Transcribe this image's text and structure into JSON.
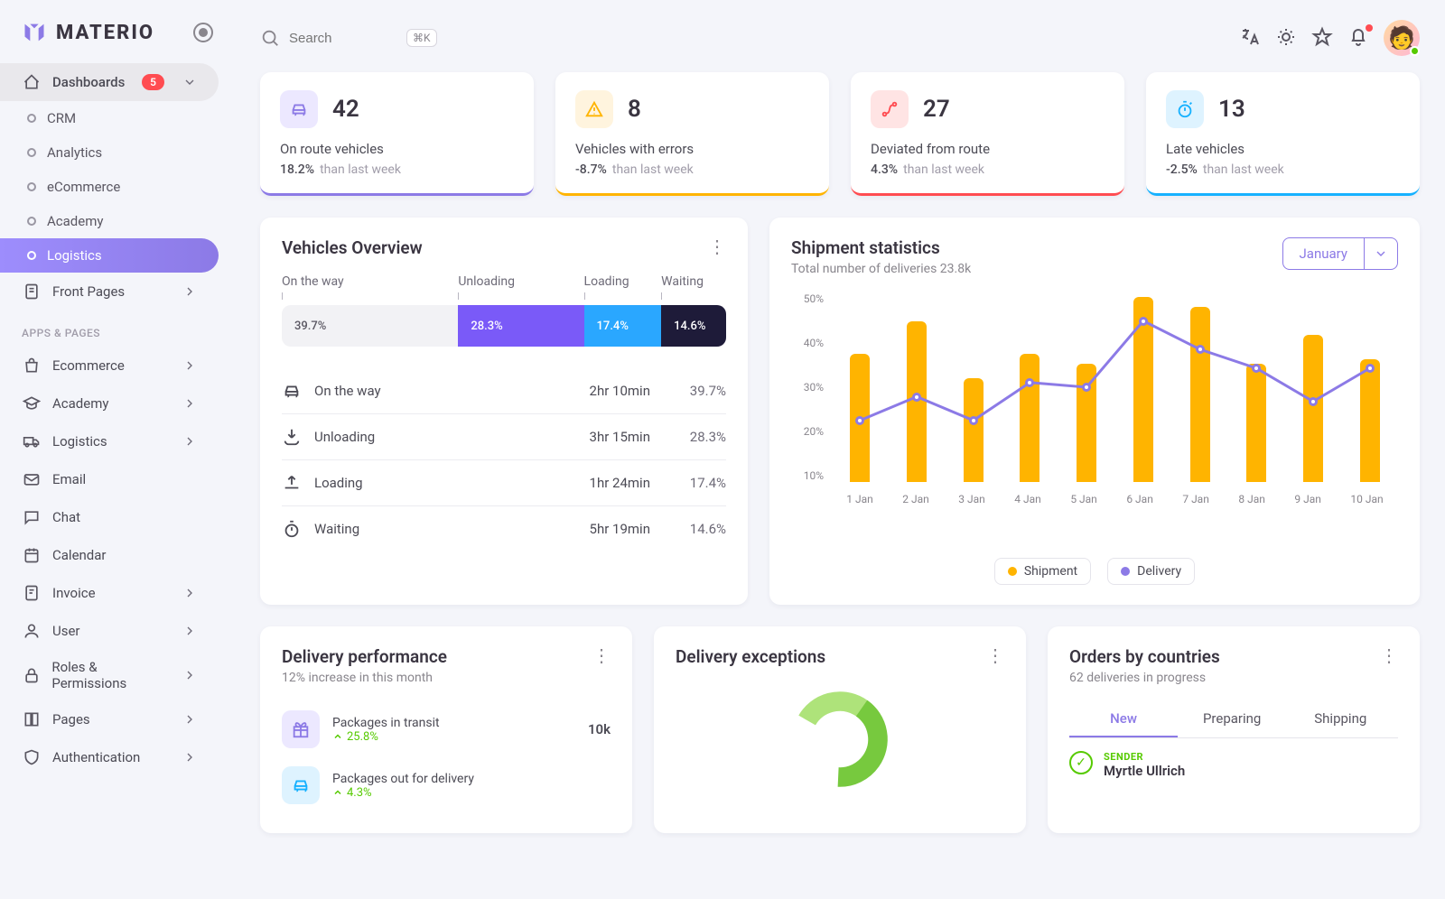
{
  "brand": "MATERIO",
  "search": {
    "placeholder": "Search",
    "kbd": "⌘K"
  },
  "sidebar": {
    "dashboards_label": "Dashboards",
    "dashboards_badge": "5",
    "subs": [
      {
        "label": "CRM"
      },
      {
        "label": "Analytics"
      },
      {
        "label": "eCommerce"
      },
      {
        "label": "Academy"
      },
      {
        "label": "Logistics"
      }
    ],
    "front_pages": "Front Pages",
    "section_heading": "APPS & PAGES",
    "apps": [
      {
        "label": "Ecommerce",
        "chev": true
      },
      {
        "label": "Academy",
        "chev": true
      },
      {
        "label": "Logistics",
        "chev": true
      },
      {
        "label": "Email",
        "chev": false
      },
      {
        "label": "Chat",
        "chev": false
      },
      {
        "label": "Calendar",
        "chev": false
      },
      {
        "label": "Invoice",
        "chev": true
      },
      {
        "label": "User",
        "chev": true
      },
      {
        "label": "Roles & Permissions",
        "chev": true
      },
      {
        "label": "Pages",
        "chev": true
      },
      {
        "label": "Authentication",
        "chev": true
      }
    ]
  },
  "stats": [
    {
      "value": "42",
      "label": "On route vehicles",
      "pct": "18.2%",
      "suffix": "than last week"
    },
    {
      "value": "8",
      "label": "Vehicles with errors",
      "pct": "-8.7%",
      "suffix": "than last week"
    },
    {
      "value": "27",
      "label": "Deviated from route",
      "pct": "4.3%",
      "suffix": "than last week"
    },
    {
      "value": "13",
      "label": "Late vehicles",
      "pct": "-2.5%",
      "suffix": "than last week"
    }
  ],
  "overview": {
    "title": "Vehicles Overview",
    "heads": [
      "On the way",
      "Unloading",
      "Loading",
      "Waiting"
    ],
    "segs": [
      "39.7%",
      "28.3%",
      "17.4%",
      "14.6%"
    ],
    "rows": [
      {
        "label": "On the way",
        "time": "2hr 10min",
        "pct": "39.7%"
      },
      {
        "label": "Unloading",
        "time": "3hr 15min",
        "pct": "28.3%"
      },
      {
        "label": "Loading",
        "time": "1hr 24min",
        "pct": "17.4%"
      },
      {
        "label": "Waiting",
        "time": "5hr 19min",
        "pct": "14.6%"
      }
    ]
  },
  "shipment": {
    "title": "Shipment statistics",
    "subtitle": "Total number of deliveries 23.8k",
    "month": "January",
    "y_ticks": [
      "50%",
      "40%",
      "30%",
      "20%",
      "10%"
    ],
    "legend": [
      "Shipment",
      "Delivery"
    ]
  },
  "chart_data": {
    "type": "bar+line",
    "categories": [
      "1 Jan",
      "2 Jan",
      "3 Jan",
      "4 Jan",
      "5 Jan",
      "6 Jan",
      "7 Jan",
      "8 Jan",
      "9 Jan",
      "10 Jan"
    ],
    "series": [
      {
        "name": "Shipment",
        "type": "bar",
        "values": [
          37,
          44,
          32,
          37,
          35,
          49,
          47,
          35,
          41,
          36
        ]
      },
      {
        "name": "Delivery",
        "type": "line",
        "values": [
          23,
          28,
          23,
          31,
          30,
          44,
          38,
          34,
          27,
          34
        ]
      }
    ],
    "ylabel": "%",
    "ylim": [
      10,
      50
    ]
  },
  "perf": {
    "title": "Delivery performance",
    "subtitle": "12% increase in this month",
    "rows": [
      {
        "name": "Packages in transit",
        "change": "25.8%",
        "val": "10k"
      },
      {
        "name": "Packages out for delivery",
        "change": "4.3%",
        "val": ""
      }
    ]
  },
  "exceptions": {
    "title": "Delivery exceptions"
  },
  "orders": {
    "title": "Orders by countries",
    "subtitle": "62 deliveries in progress",
    "tabs": [
      "New",
      "Preparing",
      "Shipping"
    ],
    "sender_label": "SENDER",
    "sender_name": "Myrtle Ullrich"
  }
}
